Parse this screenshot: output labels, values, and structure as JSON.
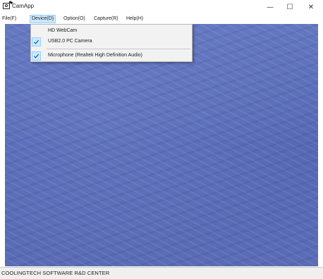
{
  "window": {
    "title": "CamApp",
    "minimize_glyph": "—",
    "maximize_glyph": "☐",
    "close_glyph": "✕"
  },
  "menubar": {
    "items": [
      {
        "label": "File(F)"
      },
      {
        "label": "Device(D)",
        "active": true
      },
      {
        "label": "Option(O)"
      },
      {
        "label": "Capture(R)"
      },
      {
        "label": "Help(H)"
      }
    ]
  },
  "device_menu": {
    "items": [
      {
        "label": "HD WebCam",
        "checked": false
      },
      {
        "label": "USB2.0 PC Camera",
        "checked": true
      },
      {
        "label": "Microphone (Realtek High Definition Audio)",
        "checked": true
      }
    ]
  },
  "statusbar": {
    "text": "COOLINGTECH SOFTWARE R&D CENTER"
  },
  "colors": {
    "preview_bg": "#5a6fb8",
    "menu_highlight": "#cce8ff",
    "check_color": "#1a5fb4"
  }
}
